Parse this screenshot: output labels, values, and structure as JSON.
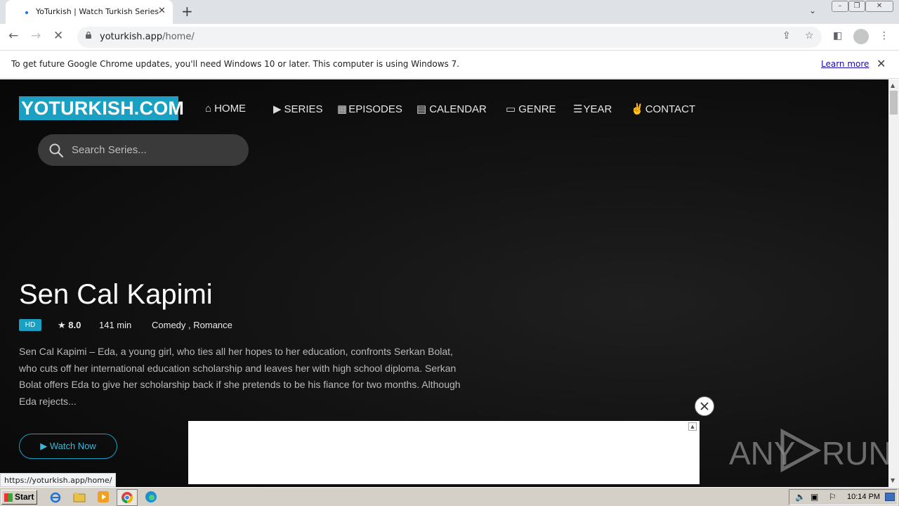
{
  "browser": {
    "tab_title": "YoTurkish | Watch Turkish Series (English Subtitles)",
    "tab_close": "✕",
    "new_tab": "+",
    "url_host": "yoturkish.app",
    "url_path": "/home/",
    "infobar_message": "To get future Google Chrome updates, you'll need Windows 10 or later. This computer is using Windows 7.",
    "infobar_link": "Learn more",
    "status_url": "https://yoturkish.app/home/"
  },
  "site": {
    "logo_text": "YOTURKISH.COM",
    "nav": [
      {
        "label": "HOME",
        "icon": "home-icon"
      },
      {
        "label": "SERIES",
        "icon": "play-icon"
      },
      {
        "label": "EPISODES",
        "icon": "grid-icon"
      },
      {
        "label": "CALENDAR",
        "icon": "calendar-icon"
      },
      {
        "label": "GENRE",
        "icon": "folder-icon"
      },
      {
        "label": "YEAR",
        "icon": "list-icon"
      },
      {
        "label": "CONTACT",
        "icon": "peace-hand-icon"
      }
    ],
    "search_placeholder": "Search Series..."
  },
  "hero": {
    "title": "Sen Cal Kapimi",
    "quality": "HD",
    "rating": "8.0",
    "duration": "141 min",
    "genres": "Comedy , Romance",
    "description": "Sen Cal Kapimi – Eda, a young girl, who ties all her hopes to her education, confronts Serkan Bolat, who cuts off her international education scholarship and leaves her with high school diploma. Serkan Bolat offers Eda to give her scholarship back if she pretends to be his fiance for two months. Although Eda rejects...",
    "watch_label": "▶ Watch Now"
  },
  "watermark": {
    "left": "ANY",
    "right": "RUN"
  },
  "taskbar": {
    "start_label": "Start",
    "clock": "10:14 PM"
  },
  "colors": {
    "accent": "#1aa0c2",
    "page_bg": "#0d0d0d"
  }
}
